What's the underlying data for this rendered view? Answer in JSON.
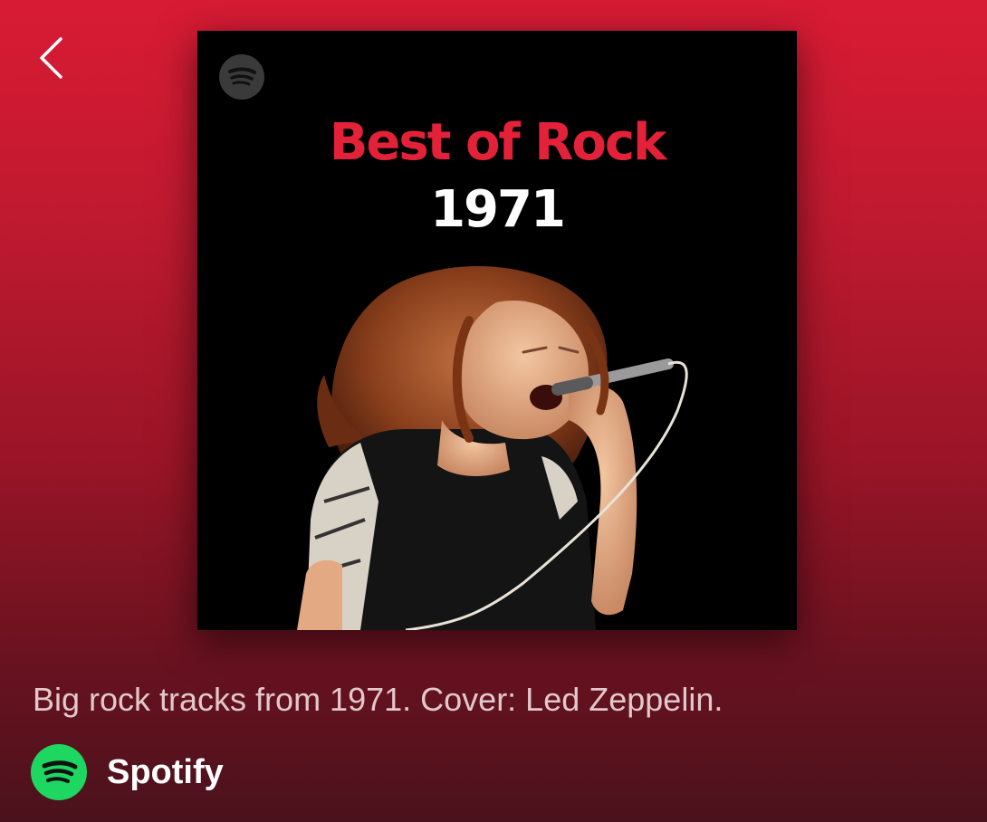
{
  "header": {
    "back_icon": "chevron-left-icon"
  },
  "cover": {
    "badge_icon": "spotify-logo-icon",
    "title": "Best of Rock",
    "year": "1971",
    "title_color": "#e3223a",
    "photo_subject": "singer-with-microphone-image"
  },
  "playlist": {
    "description": "Big rock tracks from 1971. Cover: Led Zeppelin.",
    "owner_name": "Spotify",
    "owner_icon": "spotify-logo-icon",
    "brand_color": "#1ed760"
  }
}
